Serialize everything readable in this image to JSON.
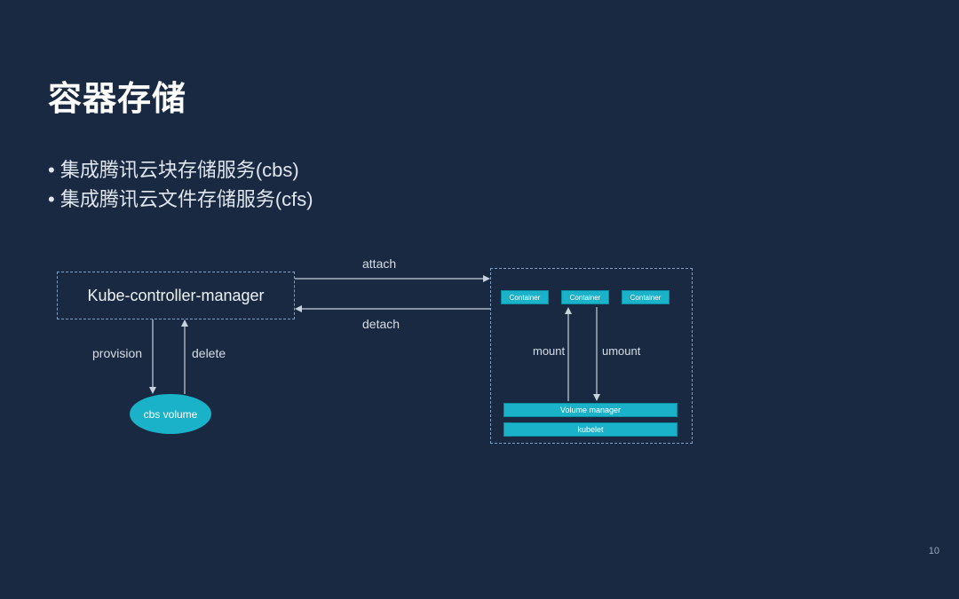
{
  "title": "容器存储",
  "bullets": [
    "集成腾讯云块存储服务(cbs)",
    "集成腾讯云文件存储服务(cfs)"
  ],
  "diagram": {
    "kcm": "Kube-controller-manager",
    "attach": "attach",
    "detach": "detach",
    "provision": "provision",
    "delete": "delete",
    "mount": "mount",
    "umount": "umount",
    "cbs_volume": "cbs volume",
    "container": "Container",
    "volume_manager": "Volume manager",
    "kubelet": "kubelet"
  },
  "page_number": "10"
}
